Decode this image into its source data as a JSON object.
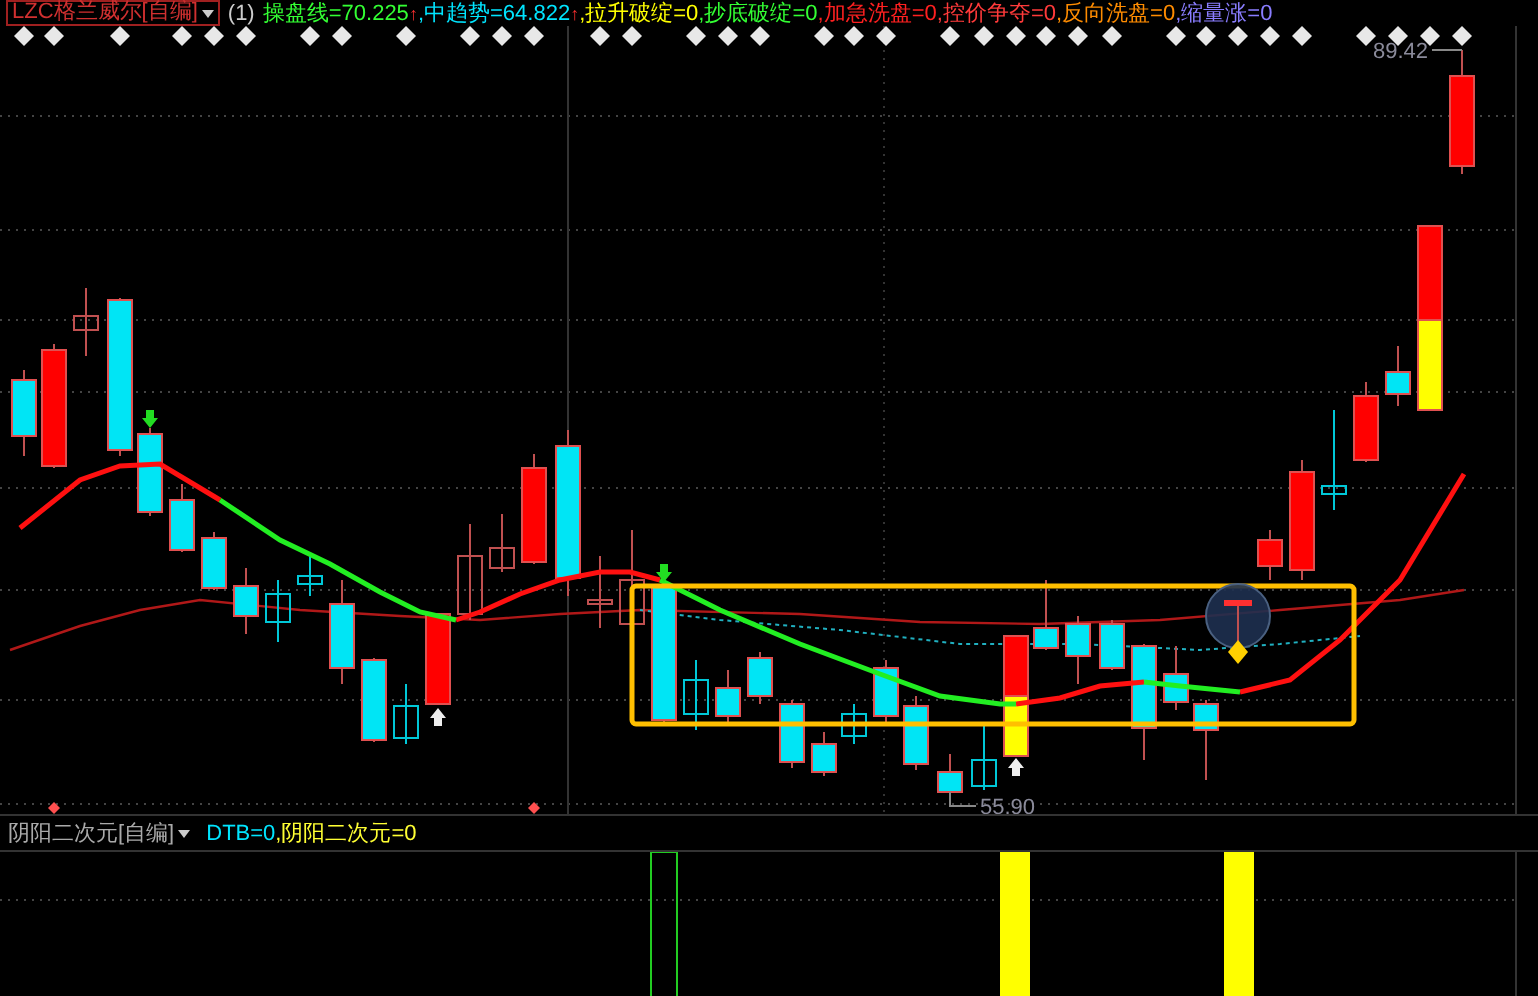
{
  "main_indicator": {
    "name": "LZC格兰威尔[自编]",
    "period": "(1)",
    "readouts": [
      {
        "text": "操盘线=70.225",
        "color": "#33ff33",
        "arrow": "↑"
      },
      {
        "text": ",中趋势=64.822",
        "color": "#00e5ff",
        "arrow": "↑"
      },
      {
        "text": ",拉升破绽=0",
        "color": "#ffff00"
      },
      {
        "text": ",抄底破绽=0",
        "color": "#33ff33"
      },
      {
        "text": ",加急洗盘=0",
        "color": "#ff2020"
      },
      {
        "text": ",控价争夺=0",
        "color": "#ff3a3a"
      },
      {
        "text": ",反向洗盘=0",
        "color": "#ff8c00"
      },
      {
        "text": ",缩量涨=0",
        "color": "#8a7dff"
      }
    ]
  },
  "price_labels": {
    "high": "89.42",
    "low": "55.90"
  },
  "sub_indicator": {
    "name": "阴阳二次元[自编]",
    "readouts": [
      {
        "text": "DTB=0",
        "color": "#00e5ff"
      },
      {
        "text": ",阴阳二次元=0",
        "color": "#ffff33"
      }
    ]
  }
}
